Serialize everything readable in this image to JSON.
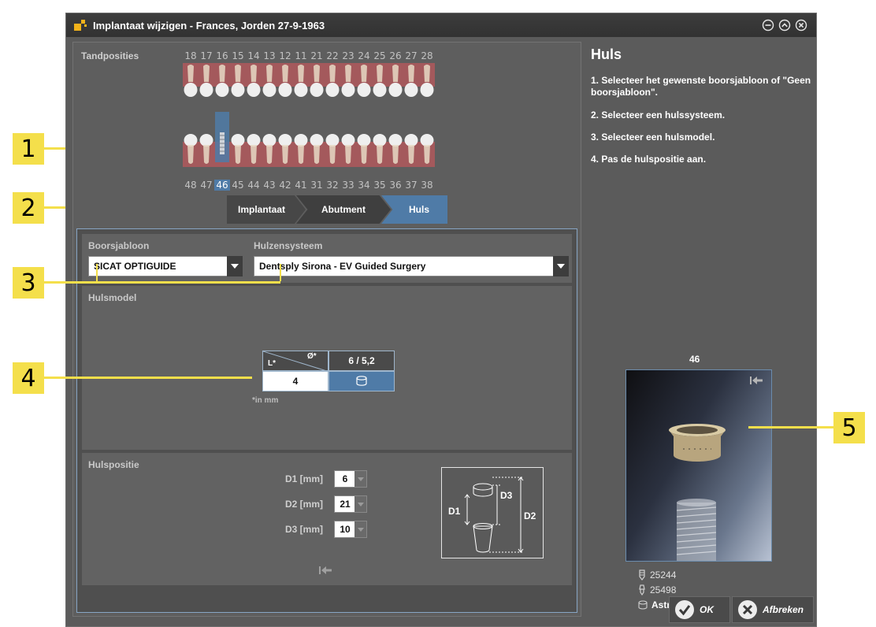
{
  "window": {
    "title": "Implantaat wijzigen - Frances, Jorden 27-9-1963",
    "controls": [
      "minimize-icon",
      "restore-icon",
      "close-icon"
    ]
  },
  "tooth_positions": {
    "label": "Tandposities",
    "upper": [
      "18",
      "17",
      "16",
      "15",
      "14",
      "13",
      "12",
      "11",
      "21",
      "22",
      "23",
      "24",
      "25",
      "26",
      "27",
      "28"
    ],
    "lower": [
      "48",
      "47",
      "46",
      "45",
      "44",
      "43",
      "42",
      "41",
      "31",
      "32",
      "33",
      "34",
      "35",
      "36",
      "37",
      "38"
    ],
    "selected": "46"
  },
  "steps": {
    "items": [
      "Implantaat",
      "Abutment",
      "Huls"
    ],
    "active": "Huls"
  },
  "boorsjabloon": {
    "label": "Boorsjabloon",
    "value": "SICAT OPTIGUIDE"
  },
  "hulzensysteem": {
    "label": "Hulzensysteem",
    "value": "Dentsply Sirona - EV Guided Surgery"
  },
  "hulsmodel": {
    "label": "Hulsmodel",
    "col_header_label": "Ø*",
    "row_header_label": "L*",
    "diameter": "6 / 5,2",
    "length": "4",
    "note": "*in mm"
  },
  "hulspositie": {
    "label": "Hulspositie",
    "fields": [
      {
        "label": "D1 [mm]",
        "value": "6"
      },
      {
        "label": "D2 [mm]",
        "value": "21"
      },
      {
        "label": "D3 [mm]",
        "value": "10"
      }
    ],
    "diagram_labels": {
      "d1": "D1",
      "d2": "D2",
      "d3": "D3"
    }
  },
  "side_panel": {
    "title": "Huls",
    "instructions": [
      "1. Selecteer het gewenste boorsjabloon of \"Geen boorsjabloon\".",
      "2. Selecteer een hulssysteem.",
      "3. Selecteer een hulsmodel.",
      "4. Pas de hulspositie aan."
    ],
    "preview_tooth": "46",
    "implant_id": "25244",
    "abutment_id": "25498",
    "sleeve_name": "AstraTech EV WD"
  },
  "buttons": {
    "ok": "OK",
    "cancel": "Afbreken"
  },
  "callouts": [
    "1",
    "2",
    "3",
    "4",
    "5"
  ],
  "colors": {
    "accent": "#4f7ba7",
    "callout": "#f4df4b",
    "gum": "#b0585c"
  }
}
